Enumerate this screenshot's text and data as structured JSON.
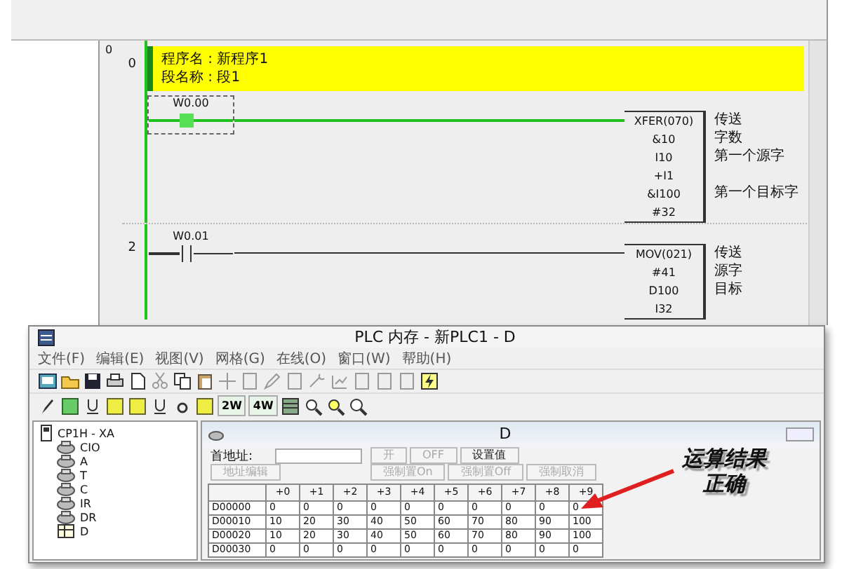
{
  "editor": {
    "corner": "0",
    "rungs": [
      {
        "number": "0",
        "header": [
          "程序名 : 新程序1",
          "段名称 : 段1"
        ],
        "contact": {
          "address": "W0.00",
          "selected": true,
          "energized": true
        },
        "instruction": {
          "name": "XFER(070)",
          "comment": "传送",
          "operands": [
            {
              "value": "&10",
              "comment": "字数"
            },
            {
              "value": "I10",
              "comment": "第一个源字"
            },
            {
              "value": "+I1"
            },
            {
              "value": "&I100",
              "comment": "第一个目标字"
            },
            {
              "value": "#32"
            }
          ]
        }
      },
      {
        "number": "2",
        "contact": {
          "address": "W0.01",
          "selected": false,
          "energized": false
        },
        "instruction": {
          "name": "MOV(021)",
          "comment": "传送",
          "operands": [
            {
              "value": "#41",
              "comment": "源字"
            },
            {
              "value": "D100",
              "comment": "目标"
            },
            {
              "value": "I32"
            }
          ]
        }
      }
    ]
  },
  "memory_window": {
    "title": "PLC 内存 - 新PLC1 - D",
    "menu": [
      "文件(F)",
      "编辑(E)",
      "视图(V)",
      "网格(G)",
      "在线(O)",
      "窗口(W)",
      "帮助(H)"
    ],
    "toolbar_labels": [
      "2W",
      "4W"
    ],
    "tree": {
      "label": "CP1H - XA",
      "children": [
        {
          "label": "CIO",
          "kind": "area"
        },
        {
          "label": "A",
          "kind": "area"
        },
        {
          "label": "T",
          "kind": "area"
        },
        {
          "label": "C",
          "kind": "area"
        },
        {
          "label": "IR",
          "kind": "area"
        },
        {
          "label": "DR",
          "kind": "area"
        },
        {
          "label": "D",
          "kind": "table"
        }
      ]
    },
    "panel": {
      "title": "D",
      "start_label": "首地址:",
      "buttons": [
        {
          "label": "开",
          "disabled": true
        },
        {
          "label": "OFF",
          "disabled": true
        },
        {
          "label": "设置值",
          "disabled": false
        }
      ],
      "buttons_2": [
        {
          "label": "地址编辑",
          "disabled": true
        },
        {
          "label": "强制置On",
          "disabled": true
        },
        {
          "label": "强制置Off",
          "disabled": true
        },
        {
          "label": "强制取消",
          "disabled": true
        }
      ],
      "columns": [
        "+0",
        "+1",
        "+2",
        "+3",
        "+4",
        "+5",
        "+6",
        "+7",
        "+8",
        "+9"
      ],
      "rows": [
        {
          "address": "D00000",
          "values": [
            "0",
            "0",
            "0",
            "0",
            "0",
            "0",
            "0",
            "0",
            "0",
            "0"
          ]
        },
        {
          "address": "D00010",
          "values": [
            "10",
            "20",
            "30",
            "40",
            "50",
            "60",
            "70",
            "80",
            "90",
            "100"
          ]
        },
        {
          "address": "D00020",
          "values": [
            "10",
            "20",
            "30",
            "40",
            "50",
            "60",
            "70",
            "80",
            "90",
            "100"
          ]
        },
        {
          "address": "D00030",
          "values": [
            "0",
            "0",
            "0",
            "0",
            "0",
            "0",
            "0",
            "0",
            "0",
            "0"
          ]
        }
      ]
    }
  },
  "annotation": {
    "lines": [
      "运算结果",
      "正确"
    ]
  }
}
